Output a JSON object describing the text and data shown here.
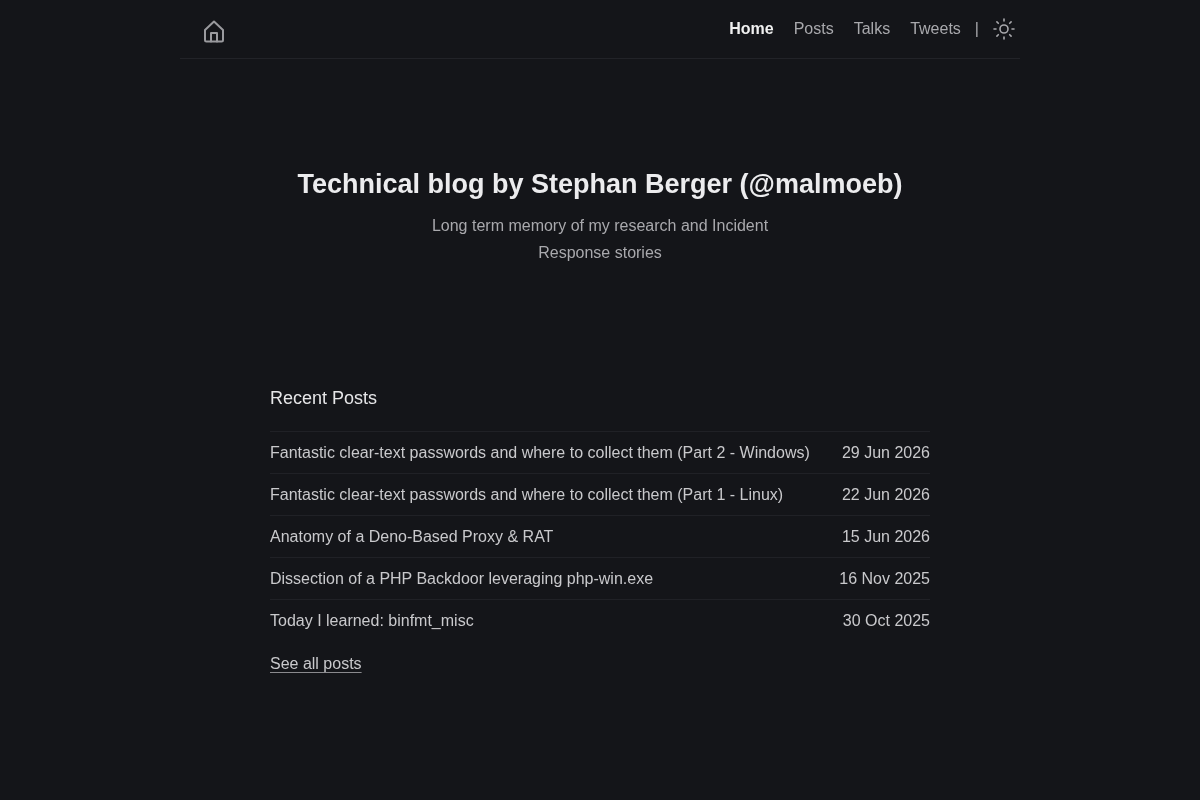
{
  "header": {
    "nav": [
      {
        "label": "Home",
        "selected": true
      },
      {
        "label": "Posts",
        "selected": false
      },
      {
        "label": "Talks",
        "selected": false
      },
      {
        "label": "Tweets",
        "selected": false
      }
    ],
    "separator": "|"
  },
  "hero": {
    "title": "Technical blog by Stephan Berger (@malmoeb)",
    "subtitle": "Long term memory of my research and Incident Response stories"
  },
  "recent_posts": {
    "heading": "Recent Posts",
    "posts": [
      {
        "title": "Fantastic clear-text passwords and where to collect them (Part 2 - Windows)",
        "date": "29 Jun 2026"
      },
      {
        "title": "Fantastic clear-text passwords and where to collect them (Part 1 - Linux)",
        "date": "22 Jun 2026"
      },
      {
        "title": "Anatomy of a Deno-Based Proxy & RAT",
        "date": "15 Jun 2026"
      },
      {
        "title": "Dissection of a PHP Backdoor leveraging php-win.exe",
        "date": "16 Nov 2025"
      },
      {
        "title": "Today I learned: binfmt_misc",
        "date": "30 Oct 2025"
      }
    ],
    "see_all": "See all posts"
  }
}
